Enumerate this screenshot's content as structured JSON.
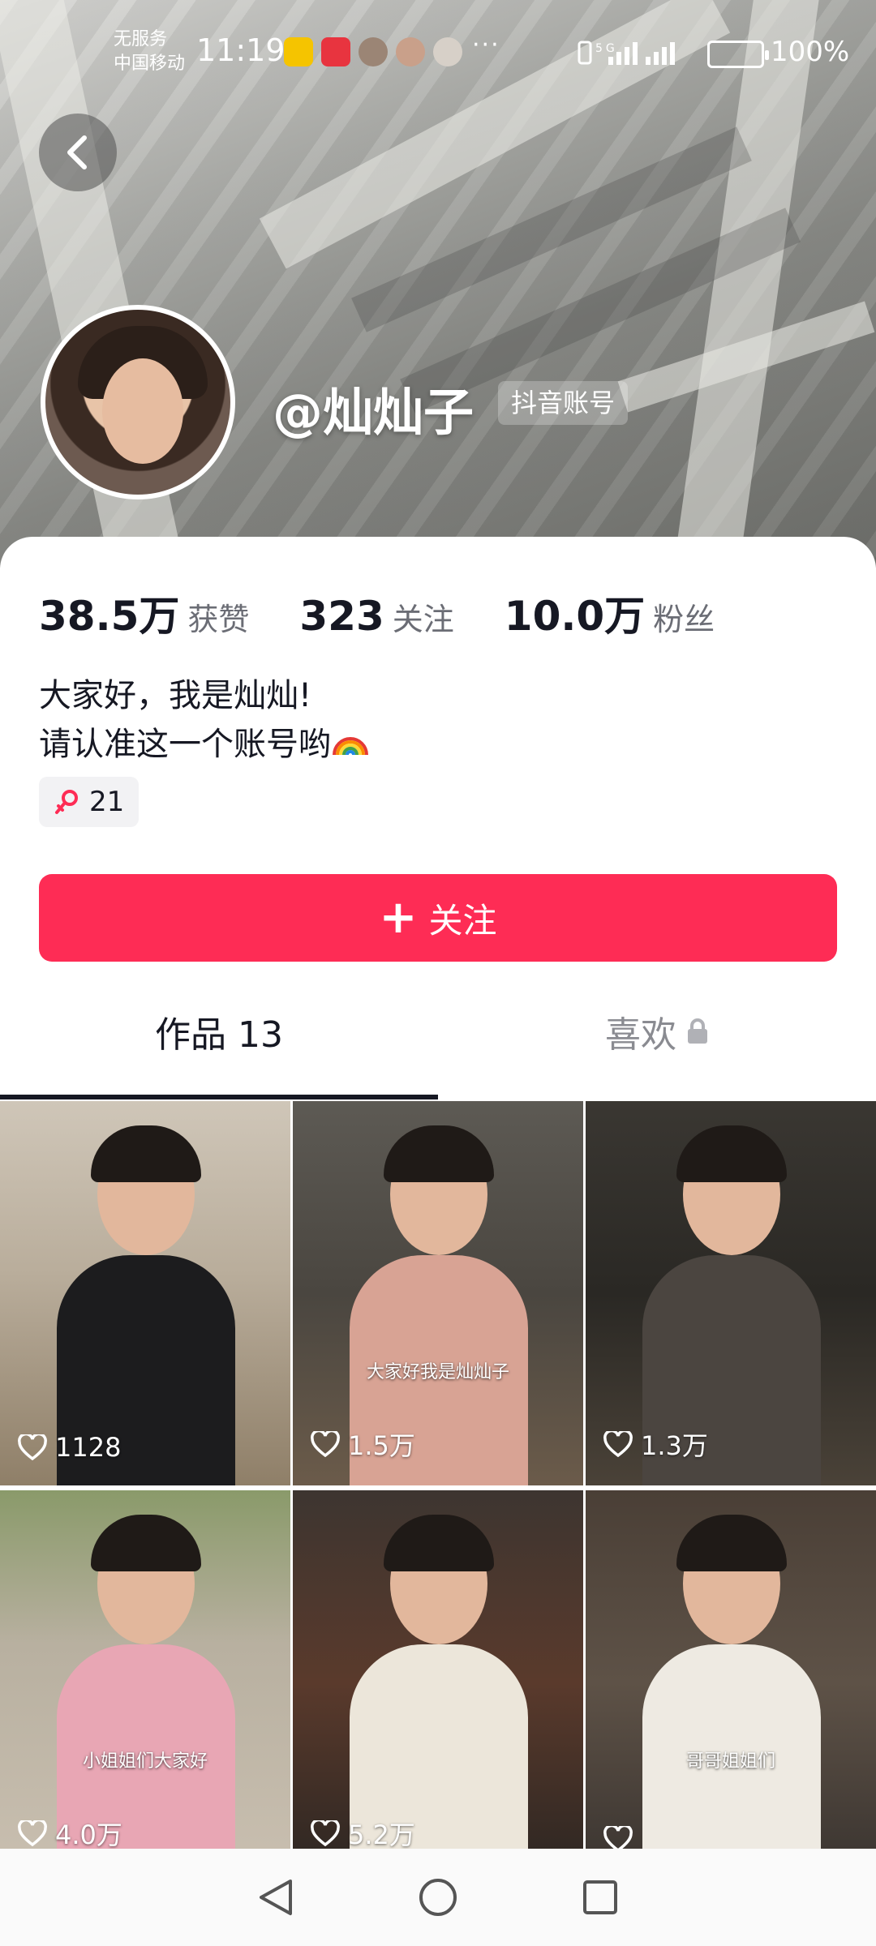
{
  "status_bar": {
    "carrier_line1": "无服务",
    "carrier_line2": "中国移动",
    "time": "11:19",
    "battery": "100%",
    "more": "···"
  },
  "profile": {
    "nickname": "@灿灿子",
    "account_badge": "抖音账号",
    "likes_count": "38.5万",
    "likes_label": "获赞",
    "following_count": "323",
    "following_label": "关注",
    "followers_count": "10.0万",
    "followers_label": "粉丝",
    "bio_line1": "大家好，我是灿灿!",
    "bio_line2": "请认准这一个账号哟",
    "fan_club_count": "21",
    "follow_button": "关注"
  },
  "tabs": {
    "works": "作品 13",
    "likes": "喜欢"
  },
  "videos": [
    {
      "likes": "1128",
      "caption": ""
    },
    {
      "likes": "1.5万",
      "caption": "大家好我是灿灿子"
    },
    {
      "likes": "1.3万",
      "caption": ""
    },
    {
      "likes": "4.0万",
      "caption": "小姐姐们大家好"
    },
    {
      "likes": "5.2万",
      "caption": ""
    },
    {
      "likes": "",
      "caption": "哥哥姐姐们"
    }
  ],
  "colors": {
    "accent": "#fe2c55",
    "text_primary": "#161823",
    "text_secondary": "#6b6d75"
  },
  "icons": [
    "back-arrow-icon",
    "heart-icon",
    "lock-icon",
    "plus-icon",
    "fan-club-icon",
    "nav-back-icon",
    "nav-home-icon",
    "nav-recent-icon"
  ]
}
